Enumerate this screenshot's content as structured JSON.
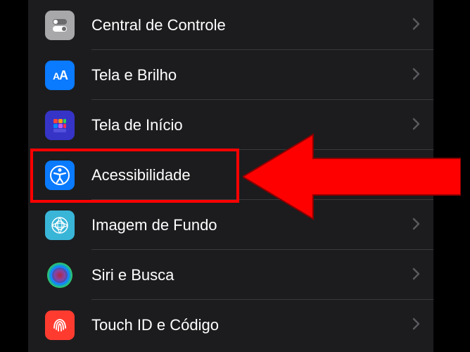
{
  "settings": {
    "items": [
      {
        "id": "control-center",
        "label": "Central de Controle"
      },
      {
        "id": "display-brightness",
        "label": "Tela e Brilho"
      },
      {
        "id": "home-screen",
        "label": "Tela de Início"
      },
      {
        "id": "accessibility",
        "label": "Acessibilidade"
      },
      {
        "id": "wallpaper",
        "label": "Imagem de Fundo"
      },
      {
        "id": "siri-search",
        "label": "Siri e Busca"
      },
      {
        "id": "touch-id",
        "label": "Touch ID e Código"
      }
    ]
  },
  "annotation": {
    "highlight_target": "accessibility",
    "highlight_color": "#ff0000",
    "arrow_color": "#ff0000"
  }
}
